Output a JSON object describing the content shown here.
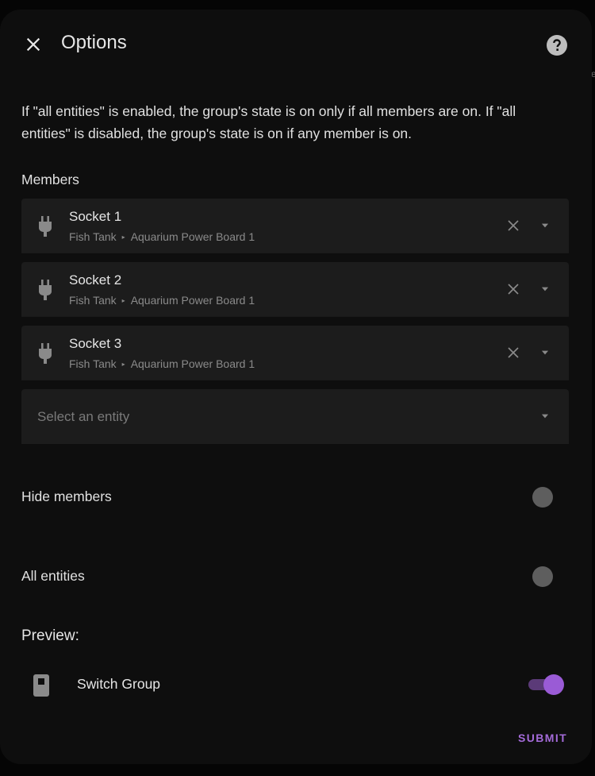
{
  "dialog": {
    "title": "Options",
    "close_icon": "close-icon",
    "help_icon": "help-circle-icon",
    "description": "If \"all entities\" is enabled, the group's state is on only if all members are on. If \"all entities\" is disabled, the group's state is on if any member is on."
  },
  "edge_text": "e",
  "members": {
    "label": "Members",
    "items": [
      {
        "name": "Socket 1",
        "area": "Fish Tank",
        "device": "Aquarium Power Board 1",
        "icon": "power-plug-icon"
      },
      {
        "name": "Socket 2",
        "area": "Fish Tank",
        "device": "Aquarium Power Board 1",
        "icon": "power-plug-icon"
      },
      {
        "name": "Socket 3",
        "area": "Fish Tank",
        "device": "Aquarium Power Board 1",
        "icon": "power-plug-icon"
      }
    ],
    "select_placeholder": "Select an entity",
    "separator": "▸"
  },
  "settings": {
    "hide_members": {
      "label": "Hide members",
      "enabled": false
    },
    "all_entities": {
      "label": "All entities",
      "enabled": false
    }
  },
  "preview": {
    "label": "Preview:",
    "entity_name": "Switch Group",
    "entity_icon": "switch-icon",
    "state_on": true
  },
  "actions": {
    "submit_label": "SUBMIT"
  },
  "colors": {
    "accent": "#9a5bd6",
    "background": "#0e0e0e",
    "field": "#1c1c1c"
  }
}
